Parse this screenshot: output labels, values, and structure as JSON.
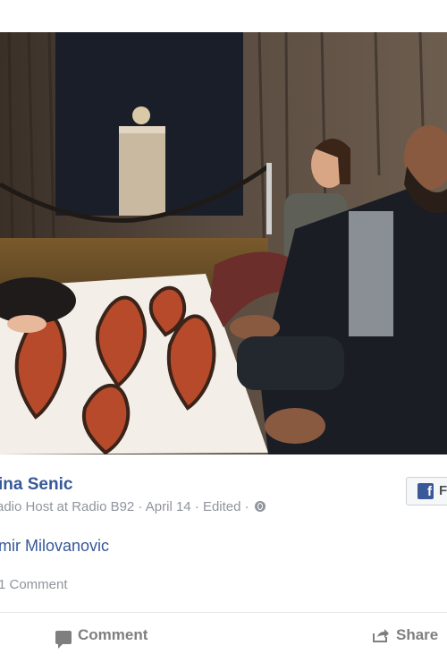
{
  "post": {
    "author": "ina Senic",
    "meta": "adio Host at Radio B92 · April 14 · Edited ·",
    "tagged": "mir Milovanovic",
    "comments_count": "1 Comment",
    "fb_button_label": "F"
  },
  "actions": {
    "comment_label": "Comment",
    "share_label": "Share"
  },
  "photo": {
    "subject": "photo"
  }
}
